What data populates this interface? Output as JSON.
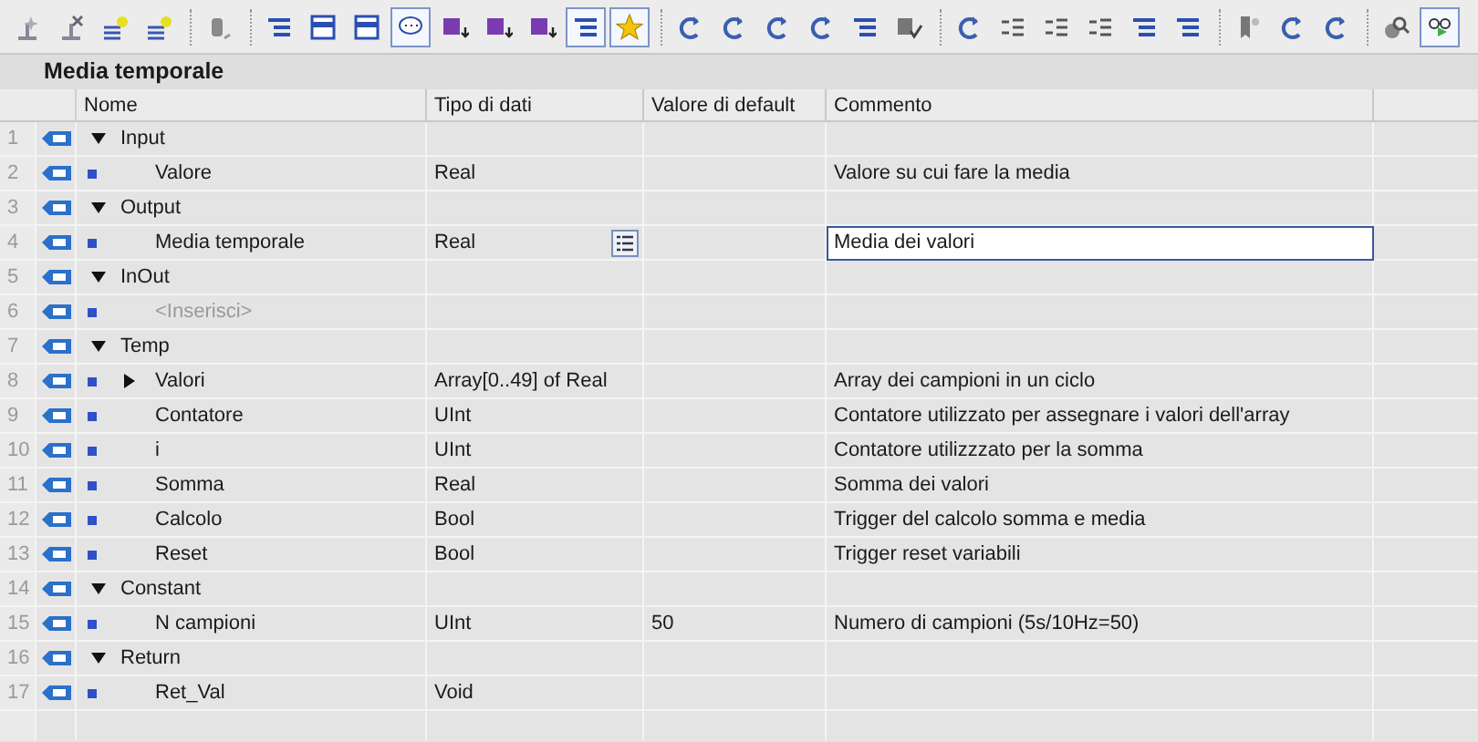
{
  "toolbar": [
    {
      "on": false
    },
    {
      "on": false
    },
    {
      "on": false
    },
    {
      "on": false
    },
    {
      "on": false,
      "separator_before": true
    },
    {
      "on": false,
      "separator_before": true
    },
    {
      "on": false
    },
    {
      "on": false
    },
    {
      "on": true
    },
    {
      "on": false
    },
    {
      "on": false
    },
    {
      "on": false
    },
    {
      "on": true
    },
    {
      "on": true
    },
    {
      "on": false,
      "separator_before": true
    },
    {
      "on": false
    },
    {
      "on": false
    },
    {
      "on": false
    },
    {
      "on": false
    },
    {
      "on": false
    },
    {
      "on": false,
      "separator_before": true
    },
    {
      "on": false
    },
    {
      "on": false
    },
    {
      "on": false
    },
    {
      "on": false
    },
    {
      "on": false
    },
    {
      "on": false,
      "separator_before": true
    },
    {
      "on": false
    },
    {
      "on": false
    },
    {
      "on": false,
      "separator_before": true
    },
    {
      "on": true
    }
  ],
  "title": "Media temporale",
  "columns": [
    "Nome",
    "Tipo di dati",
    "Valore di default",
    "Commento"
  ],
  "sections": [
    {
      "number": "1",
      "name": "Input",
      "expanded": true,
      "selected": false,
      "children": [
        {
          "number": "2",
          "name": "Valore",
          "type": "Real",
          "comment": "Valore su cui fare la media",
          "selected": false
        }
      ]
    },
    {
      "number": "3",
      "name": "Output",
      "expanded": true,
      "selected": false,
      "children": [
        {
          "number": "4",
          "name": "Media temporale",
          "type": "Real",
          "comment": "Media dei valori",
          "selected": true
        }
      ]
    },
    {
      "number": "5",
      "name": "InOut",
      "expanded": true,
      "selected": false,
      "children": [
        {
          "number": "6",
          "kind": "placeholder",
          "name": "<Inserisci>",
          "selected": false
        }
      ]
    },
    {
      "number": "7",
      "name": "Temp",
      "expanded": true,
      "selected": false,
      "children": [
        {
          "number": "8",
          "name": "Valori",
          "expanded": false,
          "type": "Array[0..49] of Real",
          "comment": "Array dei campioni in un ciclo",
          "selected": false
        },
        {
          "number": "9",
          "name": "Contatore",
          "type": "UInt",
          "comment": "Contatore utilizzato per assegnare i valori dell'array",
          "selected": false
        },
        {
          "number": "10",
          "name": "i",
          "type": "UInt",
          "comment": "Contatore utilizzzato per la somma",
          "selected": false
        },
        {
          "number": "11",
          "name": "Somma",
          "type": "Real",
          "comment": "Somma dei valori",
          "selected": false
        },
        {
          "number": "12",
          "name": "Calcolo",
          "type": "Bool",
          "comment": "Trigger del calcolo somma e media",
          "selected": false
        },
        {
          "number": "13",
          "name": "Reset",
          "type": "Bool",
          "comment": "Trigger reset variabili",
          "selected": false
        }
      ]
    },
    {
      "number": "14",
      "name": "Constant",
      "expanded": true,
      "selected": false,
      "children": [
        {
          "number": "15",
          "name": "N campioni",
          "type": "UInt",
          "default": "50",
          "comment": "Numero di campioni (5s/10Hz=50)",
          "selected": false
        }
      ]
    },
    {
      "number": "16",
      "name": "Return",
      "expanded": true,
      "selected": false,
      "children": [
        {
          "number": "17",
          "name": "Ret_Val",
          "type": "Void",
          "selected": false
        }
      ]
    }
  ]
}
